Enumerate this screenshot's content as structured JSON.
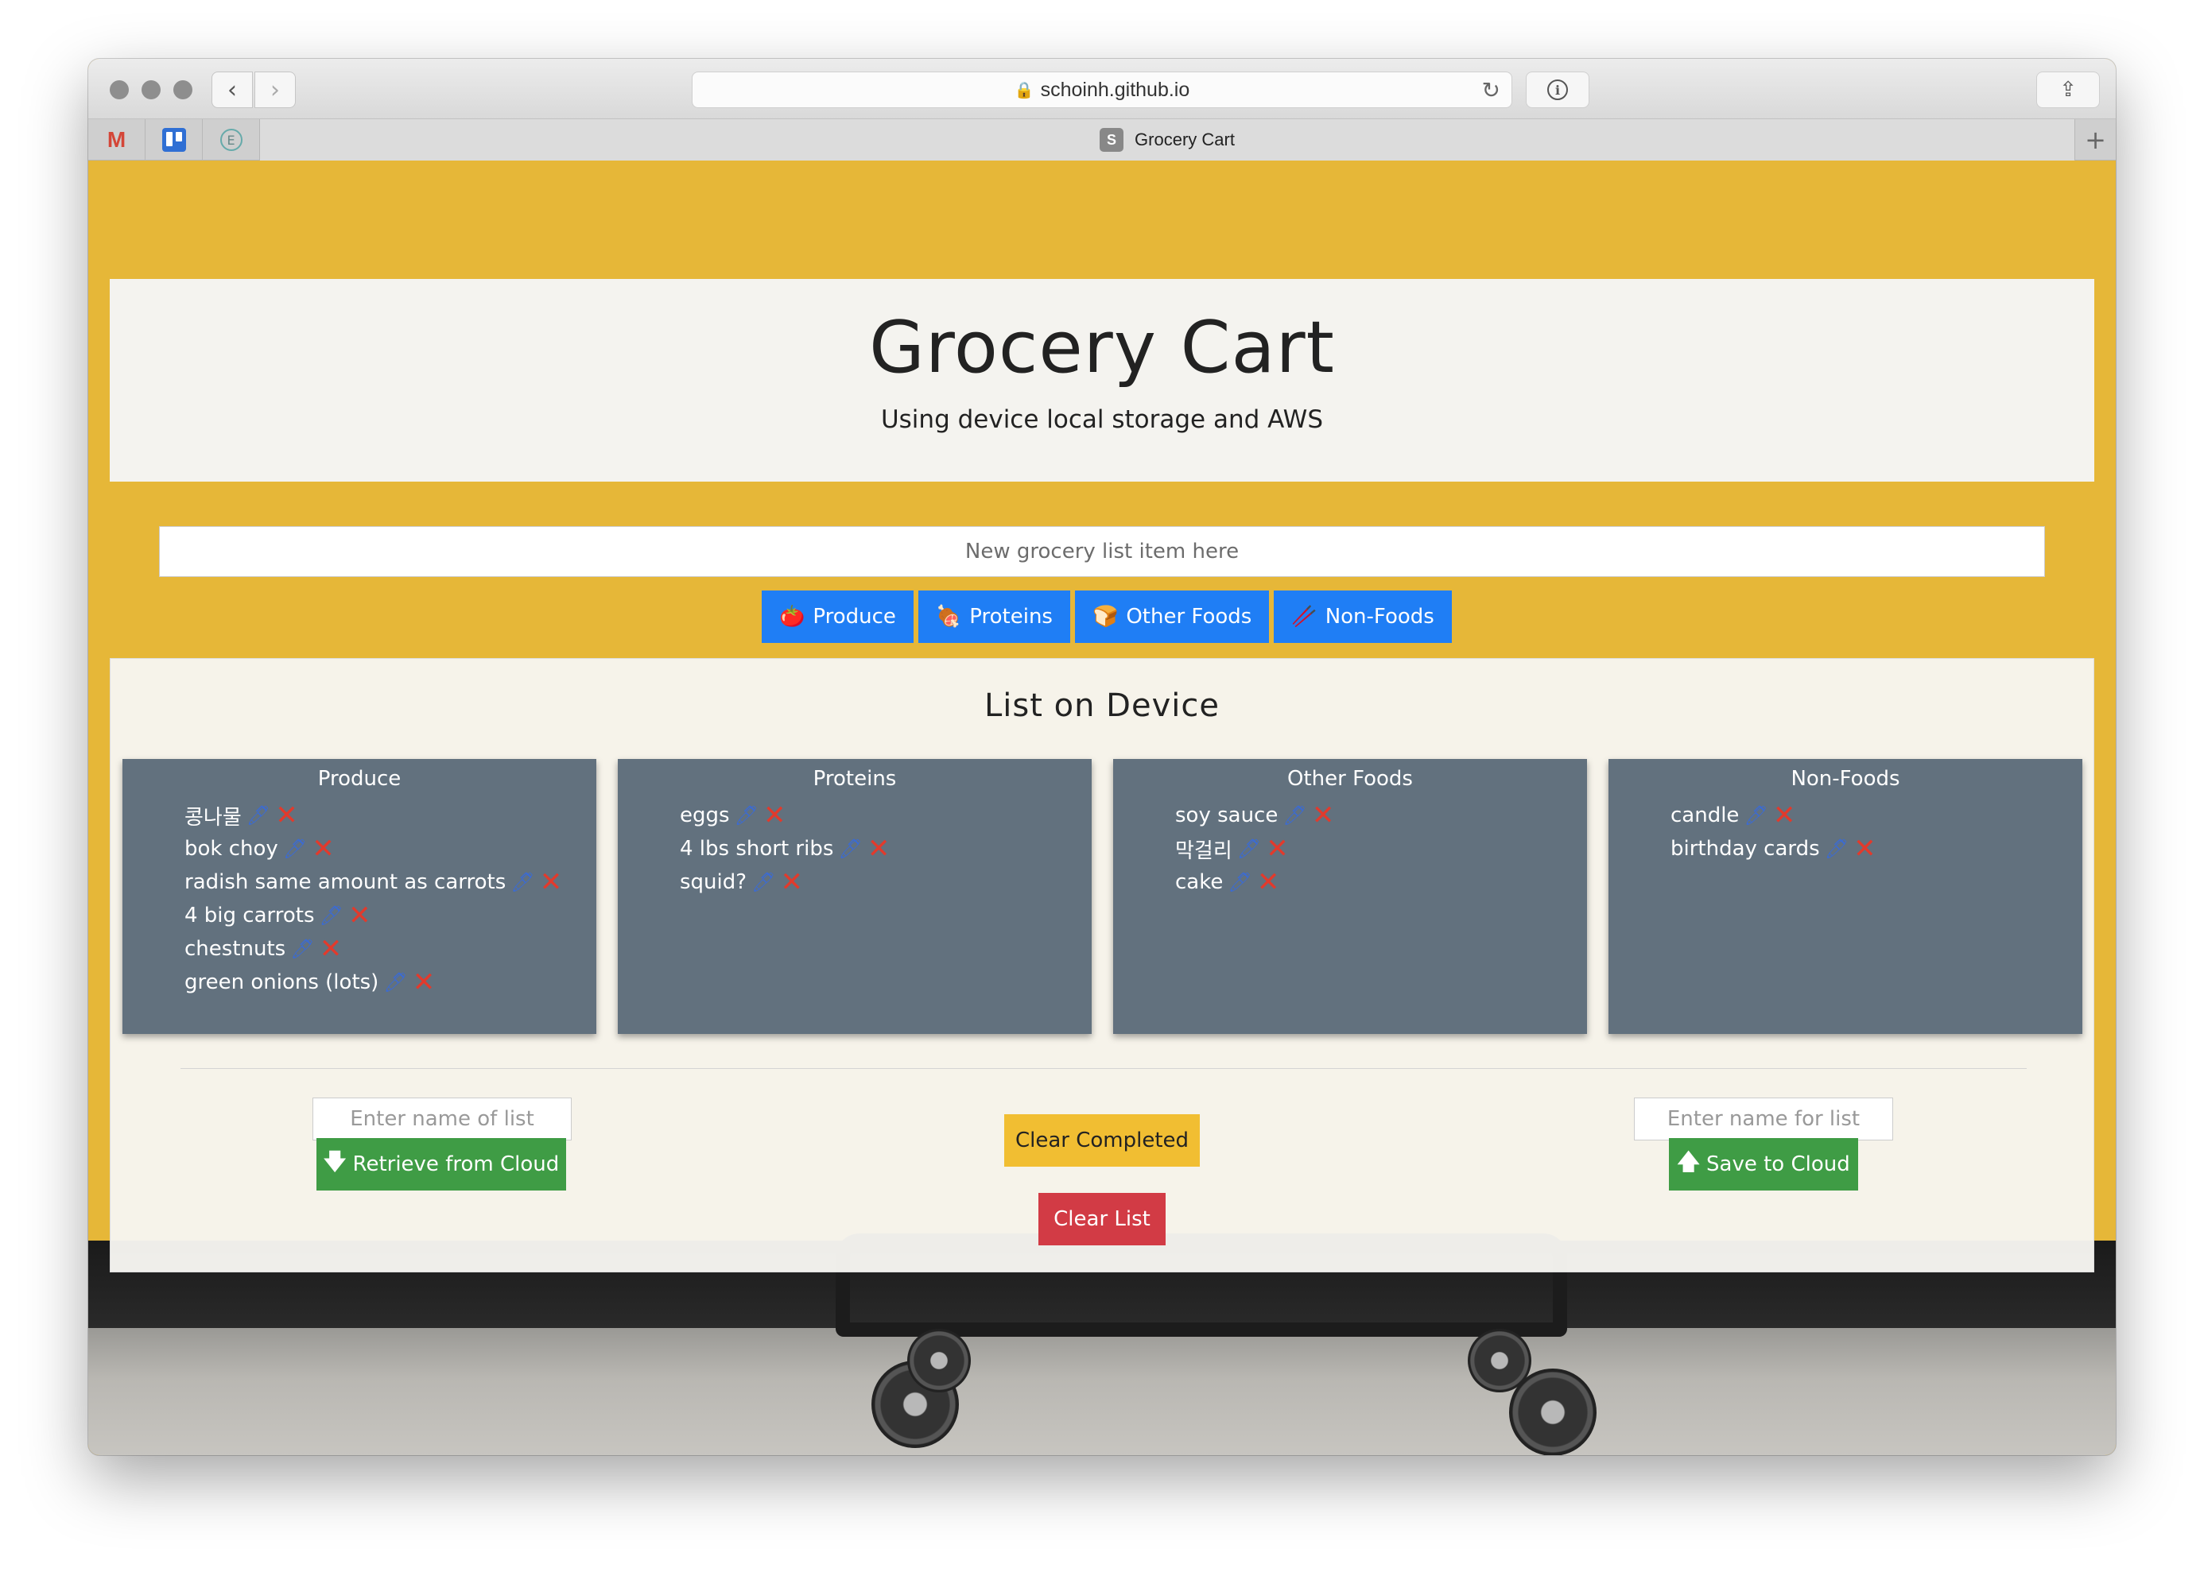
{
  "browser": {
    "url": "schoinh.github.io",
    "tab_title": "Grocery Cart",
    "tab_favicon": "S",
    "pinned_tabs": [
      "gmail-icon",
      "trello-icon",
      "evernote-icon"
    ],
    "pinned_gmail_label": "M",
    "pinned_evernote_label": "E"
  },
  "header": {
    "title": "Grocery Cart",
    "subtitle": "Using device local storage and AWS"
  },
  "new_item": {
    "placeholder": "New grocery list item here"
  },
  "categories": [
    {
      "icon": "🍅",
      "label": "Produce"
    },
    {
      "icon": "🍖",
      "label": "Proteins"
    },
    {
      "icon": "🍞",
      "label": "Other Foods"
    },
    {
      "icon": "🥢",
      "label": "Non-Foods"
    }
  ],
  "list": {
    "title": "List on Device",
    "columns": [
      {
        "title": "Produce",
        "items": [
          "콩나물",
          "bok choy",
          "radish same amount as carrots",
          "4 big carrots",
          "chestnuts",
          "green onions (lots)"
        ]
      },
      {
        "title": "Proteins",
        "items": [
          "eggs",
          "4 lbs short ribs",
          "squid?"
        ]
      },
      {
        "title": "Other Foods",
        "items": [
          "soy sauce",
          "막걸리",
          "cake"
        ]
      },
      {
        "title": "Non-Foods",
        "items": [
          "candle",
          "birthday cards"
        ]
      }
    ],
    "edit_icon": "🖊",
    "delete_icon": "✕"
  },
  "cloud": {
    "retrieve_placeholder": "Enter name of list",
    "retrieve_label": "Retrieve from Cloud",
    "save_placeholder": "Enter name for list",
    "save_label": "Save to Cloud",
    "down_arrow": "🡇",
    "up_arrow": "🡅"
  },
  "actions": {
    "clear_completed": "Clear Completed",
    "clear_list": "Clear List"
  },
  "colors": {
    "background_yellow": "#e6b738",
    "column_bg": "#62717e",
    "category_blue": "#1f7ef5",
    "success_green": "#3f9c45",
    "warning_yellow": "#f1be32",
    "danger_red": "#d23b45"
  }
}
